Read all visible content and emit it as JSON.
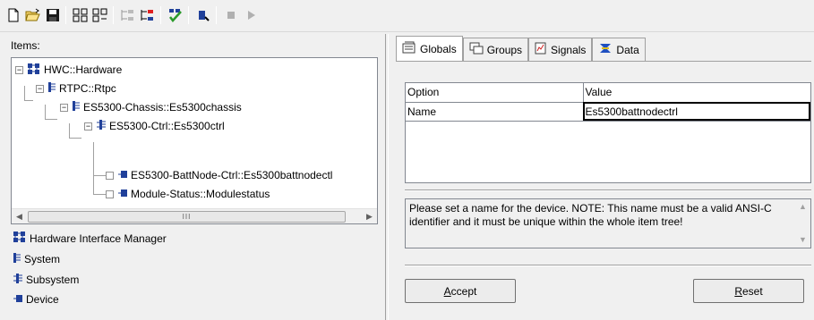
{
  "toolbar": {
    "buttons": [
      "new-icon",
      "open-icon",
      "save-icon",
      "expand-tree-icon",
      "collapse-tree-icon",
      "move-up-icon",
      "move-down-icon",
      "check-icon",
      "run-icon",
      "stop-icon",
      "play-icon"
    ]
  },
  "left": {
    "items_label": "Items:",
    "tree": [
      {
        "label": "HWC::Hardware",
        "expander": "⊟"
      },
      {
        "label": "RTPC::Rtpc",
        "expander": "⊟"
      },
      {
        "label": "ES5300-Chassis::Es5300chassis",
        "expander": "⊟"
      },
      {
        "label": "ES5300-Ctrl::Es5300ctrl",
        "expander": "⊟"
      },
      {
        "label": "ES5300-BattNode-Ctrl::Es5300battnodectl"
      },
      {
        "label": "Module-Status::Modulestatus"
      }
    ],
    "scroll_thumb": "III",
    "legend": [
      {
        "label": "Hardware Interface Manager"
      },
      {
        "label": "System"
      },
      {
        "label": "Subsystem"
      },
      {
        "label": "Device"
      }
    ]
  },
  "right": {
    "tabs": [
      {
        "label": "Globals"
      },
      {
        "label": "Groups"
      },
      {
        "label": "Signals"
      },
      {
        "label": "Data"
      }
    ],
    "grid": {
      "headers": [
        "Option",
        "Value"
      ],
      "rows": [
        {
          "option": "Name",
          "value": "Es5300battnodectrl"
        }
      ]
    },
    "note": "Please set a name for the device. NOTE: This name must be a valid ANSI-C identifier and it must be unique within the whole item tree!",
    "accept_prefix": "A",
    "accept_rest": "ccept",
    "reset_prefix": "R",
    "reset_rest": "eset"
  }
}
